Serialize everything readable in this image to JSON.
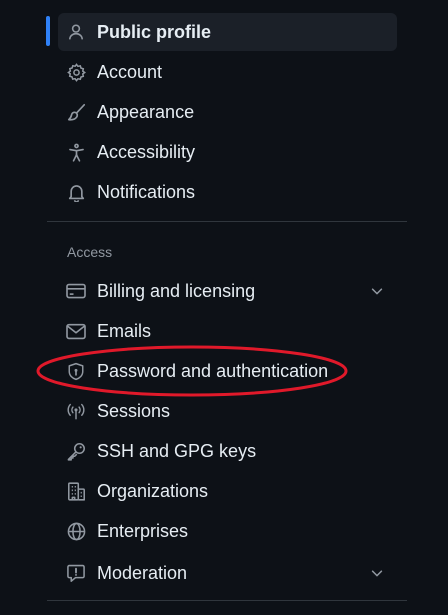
{
  "nav": {
    "items": [
      {
        "label": "Public profile",
        "icon": "person-icon"
      },
      {
        "label": "Account",
        "icon": "gear-icon"
      },
      {
        "label": "Appearance",
        "icon": "paintbrush-icon"
      },
      {
        "label": "Accessibility",
        "icon": "accessibility-icon"
      },
      {
        "label": "Notifications",
        "icon": "bell-icon"
      }
    ],
    "access_heading": "Access",
    "access_items": [
      {
        "label": "Billing and licensing",
        "icon": "credit-card-icon"
      },
      {
        "label": "Emails",
        "icon": "mail-icon"
      },
      {
        "label": "Password and authentication",
        "icon": "shield-lock-icon"
      },
      {
        "label": "Sessions",
        "icon": "broadcast-icon"
      },
      {
        "label": "SSH and GPG keys",
        "icon": "key-icon"
      },
      {
        "label": "Organizations",
        "icon": "organization-icon"
      },
      {
        "label": "Enterprises",
        "icon": "globe-icon"
      },
      {
        "label": "Moderation",
        "icon": "report-icon"
      }
    ]
  },
  "colors": {
    "background": "#0d1117",
    "active_bg": "#1b2028",
    "active_indicator": "#2f81f7",
    "text": "#e6edf3",
    "muted": "#9198a1",
    "divider": "#30363d",
    "highlight": "#e0192a"
  }
}
